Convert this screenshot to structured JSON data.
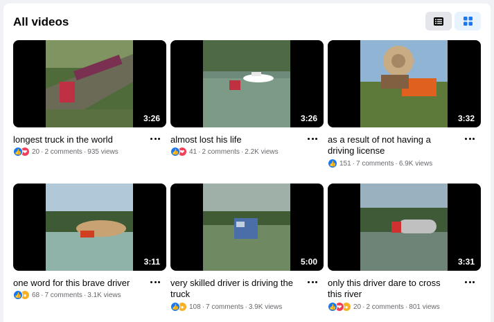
{
  "header": {
    "title": "All videos"
  },
  "icons": {
    "list_view": "list-icon",
    "grid_view": "grid-icon",
    "more": "more-dots-icon"
  },
  "colors": {
    "like": "#1877f2",
    "love": "#f33e58",
    "wow": "#f7b125",
    "active_toggle": "#1877f2"
  },
  "videos": [
    {
      "title": "longest truck in the world",
      "duration": "3:26",
      "reactions": [
        "like",
        "love"
      ],
      "reaction_count": "20",
      "comments": "2 comments",
      "views": "935 views"
    },
    {
      "title": "almost lost his life",
      "duration": "3:26",
      "reactions": [
        "like",
        "love"
      ],
      "reaction_count": "41",
      "comments": "2 comments",
      "views": "2.2K views"
    },
    {
      "title": "as a result of not having a driving license",
      "duration": "3:32",
      "reactions": [
        "like"
      ],
      "reaction_count": "151",
      "comments": "7 comments",
      "views": "6.9K views"
    },
    {
      "title": "one word for this brave driver",
      "duration": "3:11",
      "reactions": [
        "like",
        "wow"
      ],
      "reaction_count": "68",
      "comments": "7 comments",
      "views": "3.1K views"
    },
    {
      "title": "very skilled driver is driving the truck",
      "duration": "5:00",
      "reactions": [
        "like",
        "wow"
      ],
      "reaction_count": "108",
      "comments": "7 comments",
      "views": "3.9K views"
    },
    {
      "title": "only this driver dare to cross this river",
      "duration": "3:31",
      "reactions": [
        "like",
        "love",
        "haha"
      ],
      "reaction_count": "20",
      "comments": "2 comments",
      "views": "801 views"
    }
  ]
}
